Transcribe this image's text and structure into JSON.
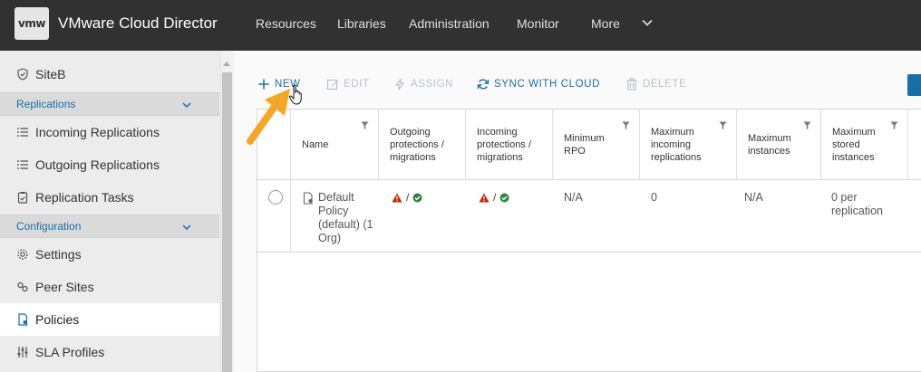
{
  "header": {
    "logo_text": "vmw",
    "title": "VMware Cloud Director",
    "nav": [
      "Resources",
      "Libraries",
      "Administration",
      "Monitor",
      "More"
    ]
  },
  "sidebar": {
    "site": "SiteB",
    "group_replications": "Replications",
    "incoming": "Incoming Replications",
    "outgoing": "Outgoing Replications",
    "tasks": "Replication Tasks",
    "group_configuration": "Configuration",
    "settings": "Settings",
    "peer_sites": "Peer Sites",
    "policies": "Policies",
    "sla_profiles": "SLA Profiles"
  },
  "toolbar": {
    "new": "NEW",
    "edit": "EDIT",
    "assign": "ASSIGN",
    "sync": "SYNC WITH CLOUD",
    "delete": "DELETE"
  },
  "grid": {
    "columns": [
      "Name",
      "Outgoing protections / migrations",
      "Incoming protections / migrations",
      "Minimum RPO",
      "Maximum incoming replications",
      "Maximum instances",
      "Maximum stored instances"
    ],
    "row": {
      "name": "Default Policy (default) (1 Org)",
      "separator": "/",
      "min_rpo": "N/A",
      "max_incoming": "0",
      "max_instances": "N/A",
      "max_stored": "0 per replication"
    }
  },
  "colors": {
    "header_bg": "#313131",
    "accent": "#1670a8",
    "warning": "#c92100",
    "success": "#2e8540",
    "annotation_arrow": "#f5a623"
  }
}
